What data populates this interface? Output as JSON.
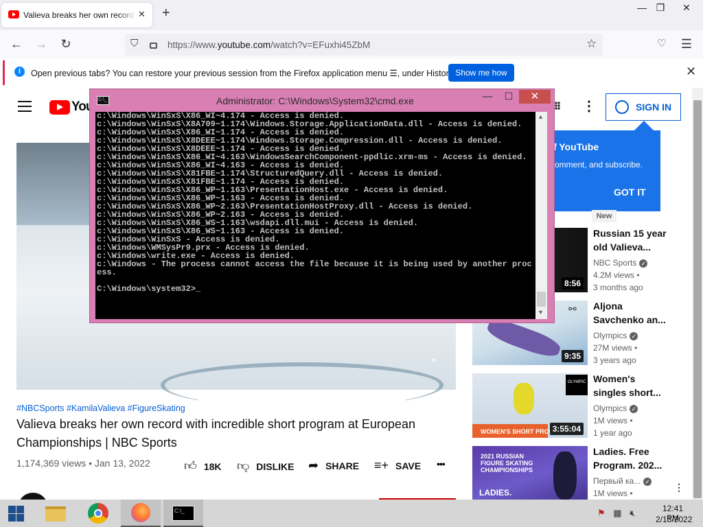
{
  "browser": {
    "tab_title": "Valieva breaks her own record with incredible short program at European Championships | NBC Sports",
    "tab_close": "✕",
    "new_tab": "+",
    "url_prefix": "https://www.",
    "url_host": "youtube.com",
    "url_path": "/watch?v=EFuxhi45ZbM",
    "notification": "Open previous tabs? You can restore your previous session from the Firefox application menu ☰, under History.",
    "notification_button": "Show me how",
    "notification_close": "✕"
  },
  "youtube": {
    "logo_text": "You",
    "signin": "SIGN IN",
    "tags": "#NBCSports #KamilaValieva #FigureSkating",
    "title": "Valieva breaks her own record with incredible short program at European Championships | NBC Sports",
    "views_date": "1,174,369 views • Jan 13, 2022",
    "likes": "18K",
    "dislike": "DISLIKE",
    "share": "SHARE",
    "save": "SAVE",
    "more": "•••",
    "popup_title": "f YouTube",
    "popup_body": "comment, and subscribe.",
    "popup_button": "GOT IT",
    "new_badge": "New",
    "recommendations": [
      {
        "title": "Russian 15 year old Valieva...",
        "channel": "NBC Sports",
        "views": "4.2M views",
        "age": "3 months ago",
        "duration": "8:56"
      },
      {
        "title": "Aljona Savchenko an...",
        "channel": "Olympics",
        "views": "27M views",
        "age": "3 years ago",
        "duration": "9:35"
      },
      {
        "title": "Women's singles short...",
        "channel": "Olympics",
        "views": "1M views",
        "age": "1 year ago",
        "duration": "3:55:04",
        "thumb_text": "WOMEN'S SHORT PROGRAM -"
      },
      {
        "title": "Ladies. Free Program. 202...",
        "channel": "Первый ка...",
        "views": "1M views",
        "age": "",
        "duration": "",
        "thumb_text": "2021 RUSSIAN FIGURE SKATING CHAMPIONSHIPS",
        "thumb_text2": "LADIES."
      }
    ]
  },
  "cmd": {
    "title": "Administrator: C:\\Windows\\System32\\cmd.exe",
    "icon_text": "C:\\_",
    "lines": "c:\\Windows\\WinSxS\\X86_WI~4.174 - Access is denied.\nc:\\Windows\\WinSxS\\X8A709~1.174\\Windows.Storage.ApplicationData.dll - Access is denied.\nc:\\Windows\\WinSxS\\X86_WI~1.174 - Access is denied.\nc:\\Windows\\WinSxS\\X8DEEE~1.174\\Windows.Storage.Compression.dll - Access is denied.\nc:\\Windows\\WinSxS\\X8DEEE~1.174 - Access is denied.\nc:\\Windows\\WinSxS\\X86_WI~4.163\\WindowsSearchComponent-ppdlic.xrm-ms - Access is denied.\nc:\\Windows\\WinSxS\\X86_WI~4.163 - Access is denied.\nc:\\Windows\\WinSxS\\X81FBE~1.174\\StructuredQuery.dll - Access is denied.\nc:\\Windows\\WinSxS\\X81FBE~1.174 - Access is denied.\nc:\\Windows\\WinSxS\\X86_WP~1.163\\PresentationHost.exe - Access is denied.\nc:\\Windows\\WinSxS\\X86_WP~1.163 - Access is denied.\nc:\\Windows\\WinSxS\\X86_WP~2.163\\PresentationHostProxy.dll - Access is denied.\nc:\\Windows\\WinSxS\\X86_WP~2.163 - Access is denied.\nc:\\Windows\\WinSxS\\X86_WS~1.163\\wsdapi.dll.mui - Access is denied.\nc:\\Windows\\WinSxS\\X86_WS~1.163 - Access is denied.\nc:\\Windows\\WinSxS - Access is denied.\nc:\\Windows\\WMSysPr9.prx - Access is denied.\nc:\\Windows\\write.exe - Access is denied.\nc:\\Windows - The process cannot access the file because it is being used by another process.\n\nC:\\Windows\\system32>_"
  },
  "taskbar": {
    "time": "12:41 PM",
    "date": "2/13/2022",
    "cmd_icon": "C:\\_"
  },
  "colors": {
    "youtube_red": "#ff0000",
    "link_blue": "#065fd4",
    "cmd_frame": "#d97fb4",
    "firefox_button": "#0061e0"
  }
}
